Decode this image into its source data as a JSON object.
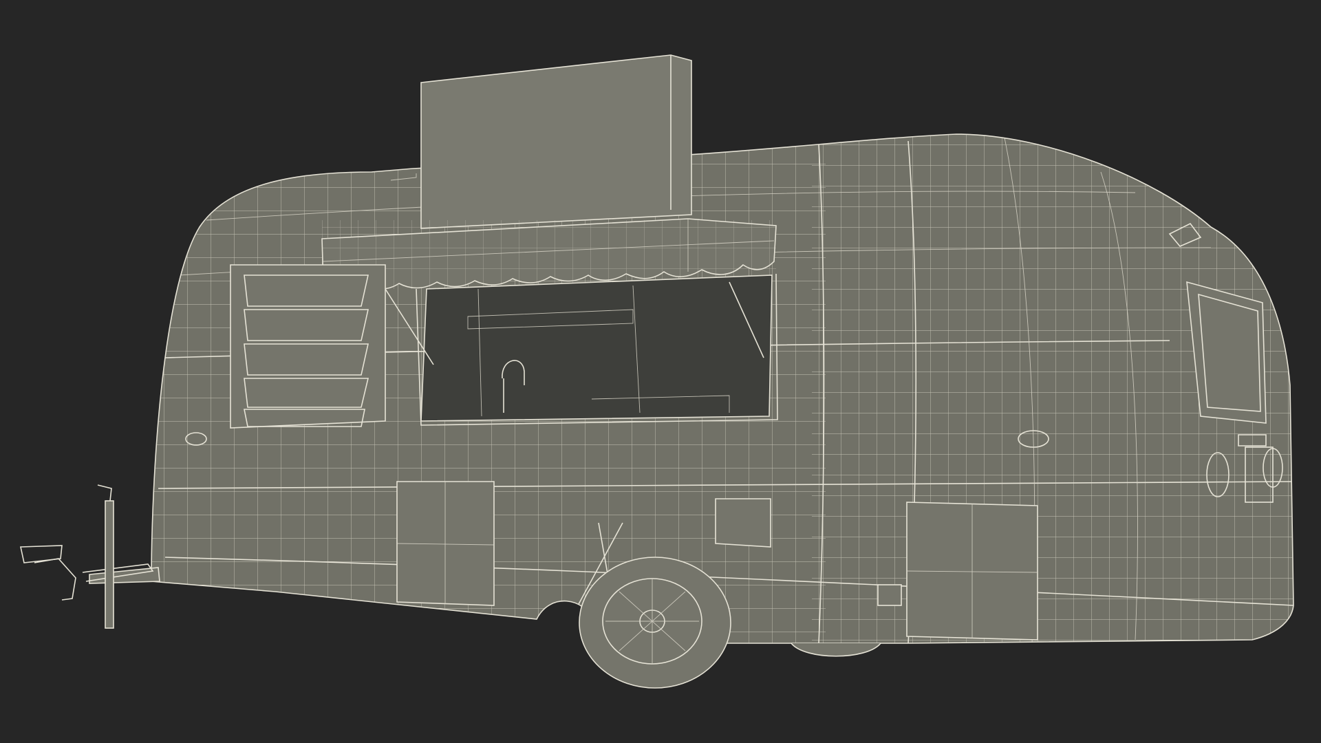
{
  "scene": {
    "subject_icon": "food-trailer-wireframe",
    "background_color": "#262626",
    "surface_color": "#717167",
    "wire_color": "#e6e3d6",
    "window_interior_color": "#3e3f3b"
  }
}
